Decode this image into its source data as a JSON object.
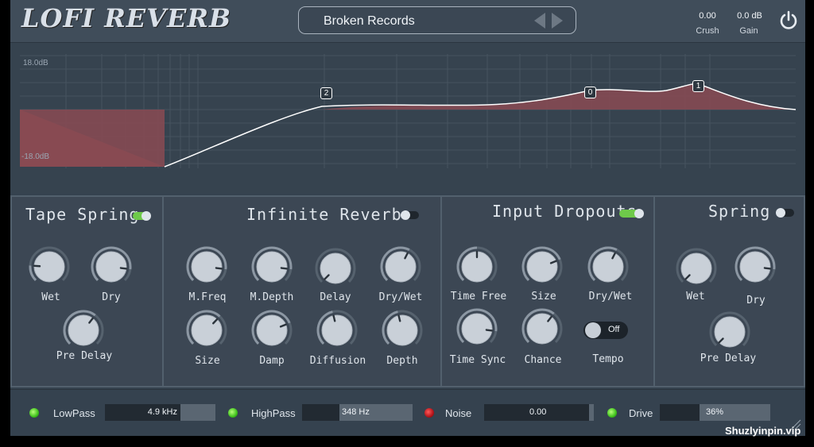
{
  "header": {
    "logo": "LOFI REVERB",
    "preset_name": "Broken Records",
    "crush": {
      "value": "0.00",
      "label": "Crush"
    },
    "gain": {
      "value": "0.0 dB",
      "label": "Gain"
    },
    "power_icon": "power-icon"
  },
  "eq": {
    "top_label": "18.0dB",
    "bottom_label": "-18.0dB",
    "nodes": [
      "2",
      "0",
      "1"
    ],
    "fill_color": "#8a4a52",
    "curve_color": "#ffffff"
  },
  "panels": {
    "tape_spring": {
      "title": "Tape Spring",
      "enabled": true,
      "knobs": [
        {
          "label": "Wet",
          "value": 0.18
        },
        {
          "label": "Dry",
          "value": 0.86
        },
        {
          "label": "Pre Delay",
          "value": 0.64
        }
      ]
    },
    "infinite_reverb": {
      "title": "Infinite Reverb",
      "enabled": false,
      "knobs": [
        {
          "label": "M.Freq",
          "value": 0.86
        },
        {
          "label": "M.Depth",
          "value": 0.86
        },
        {
          "label": "Delay",
          "value": 0.0
        },
        {
          "label": "Dry/Wet",
          "value": 0.6
        },
        {
          "label": "Size",
          "value": 0.66
        },
        {
          "label": "Damp",
          "value": 0.75
        },
        {
          "label": "Diffusion",
          "value": 0.45
        },
        {
          "label": "Depth",
          "value": 0.45
        }
      ]
    },
    "input_dropouts": {
      "title": "Input Dropouts",
      "enabled": true,
      "knobs": [
        {
          "label": "Time Free",
          "value": 0.5
        },
        {
          "label": "Size",
          "value": 0.75
        },
        {
          "label": "Dry/Wet",
          "value": 0.6
        },
        {
          "label": "Time Sync",
          "value": 0.86
        },
        {
          "label": "Chance",
          "value": 0.64
        }
      ],
      "tempo": {
        "state": "Off",
        "label": "Tempo"
      }
    },
    "spring": {
      "title": "Spring",
      "enabled": false,
      "knobs": [
        {
          "label": "Wet",
          "value": 0.0
        },
        {
          "label": "Dry",
          "value": 0.86
        },
        {
          "label": "Pre Delay",
          "value": 0.0
        }
      ]
    }
  },
  "footer": {
    "lowpass": {
      "label": "LowPass",
      "value": "4.9 kHz",
      "enabled": true,
      "fill": 0.68
    },
    "highpass": {
      "label": "HighPass",
      "value": "348 Hz",
      "enabled": true,
      "fill": 0.34
    },
    "noise": {
      "label": "Noise",
      "value": "0.00",
      "enabled": false,
      "fill": 0.96
    },
    "drive": {
      "label": "Drive",
      "value": "36%",
      "enabled": true,
      "fill": 0.36
    }
  },
  "watermark": "Shuzlyinpin.vip"
}
